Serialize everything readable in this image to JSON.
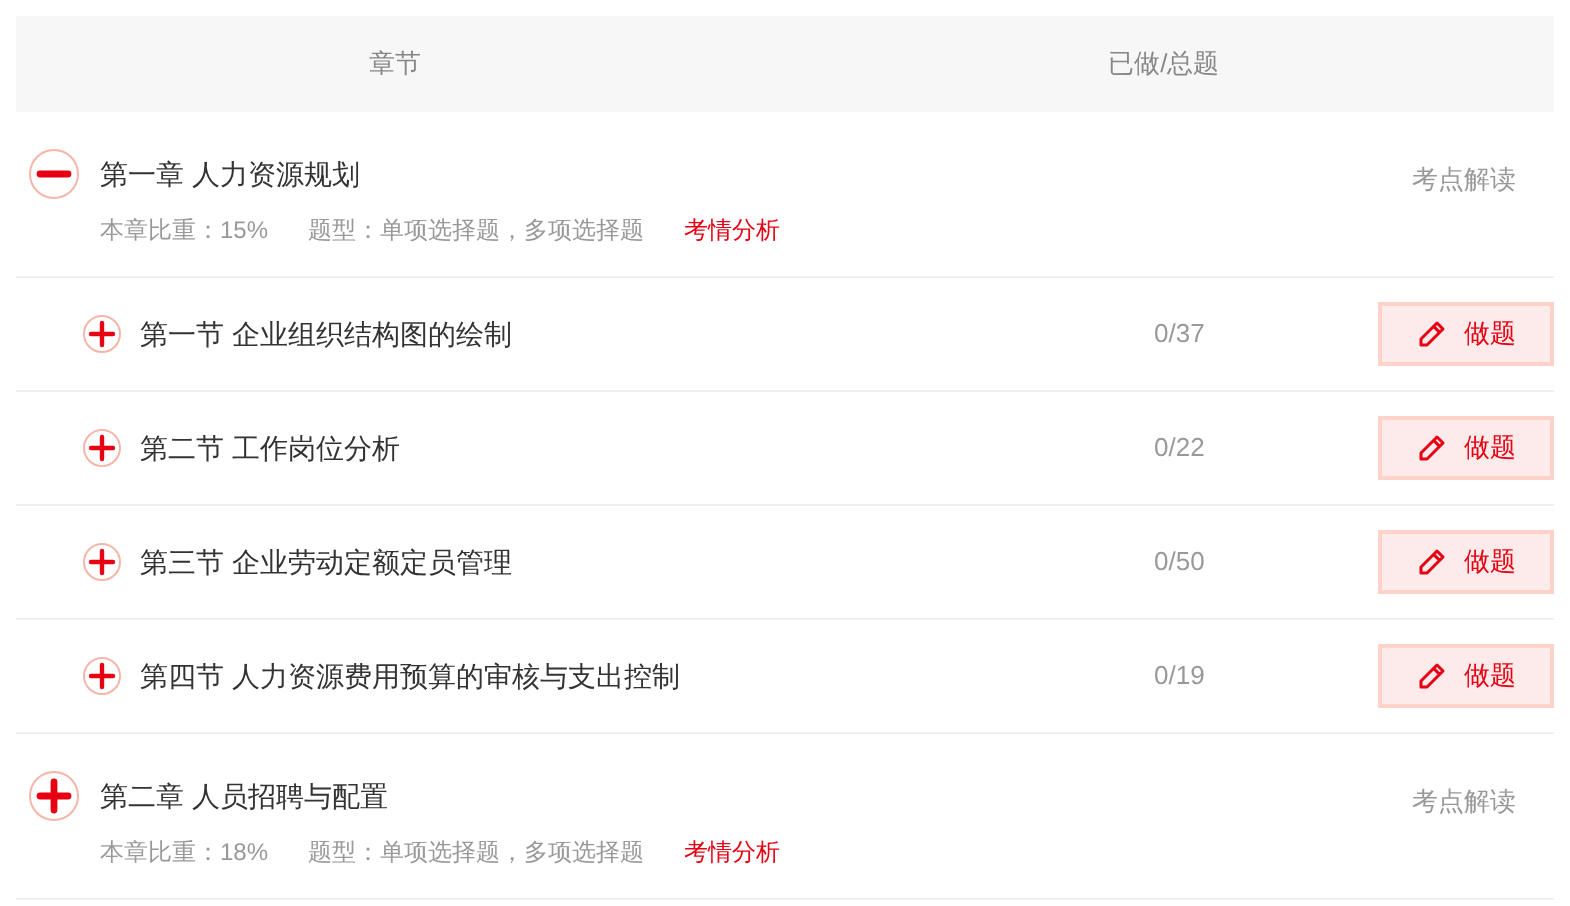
{
  "table": {
    "columns": [
      "章节",
      "已做/总题"
    ]
  },
  "chapters": [
    {
      "title": "第一章 人力资源规划",
      "expanded": true,
      "weight": "本章比重：15%",
      "types": "题型：单项选择题，多项选择题",
      "analysis_link": "考情分析",
      "interpret_link": "考点解读",
      "sections": [
        {
          "title": "第一节 企业组织结构图的绘制",
          "expanded": false,
          "progress": "0/37",
          "button": "做题"
        },
        {
          "title": "第二节 工作岗位分析",
          "expanded": false,
          "progress": "0/22",
          "button": "做题"
        },
        {
          "title": "第三节 企业劳动定额定员管理",
          "expanded": false,
          "progress": "0/50",
          "button": "做题"
        },
        {
          "title": "第四节 人力资源费用预算的审核与支出控制",
          "expanded": false,
          "progress": "0/19",
          "button": "做题"
        }
      ]
    },
    {
      "title": "第二章 人员招聘与配置",
      "expanded": false,
      "weight": "本章比重：18%",
      "types": "题型：单项选择题，多项选择题",
      "analysis_link": "考情分析",
      "interpret_link": "考点解读"
    }
  ]
}
